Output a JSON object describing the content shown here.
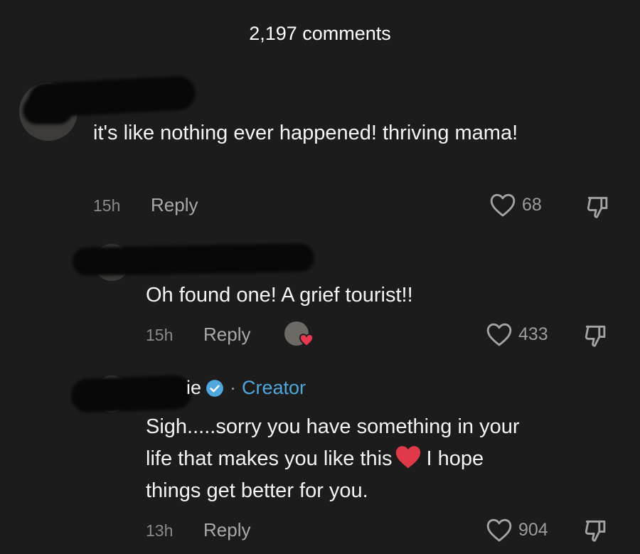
{
  "header": {
    "comment_count": "2,197 comments"
  },
  "comments": [
    {
      "text": "it's like nothing ever happened! thriving mama!",
      "time": "15h",
      "reply_label": "Reply",
      "likes": "68"
    },
    {
      "text": "Oh found one! A grief tourist!!",
      "time": "15h",
      "reply_label": "Reply",
      "likes": "433"
    },
    {
      "name_suffix": "ie",
      "creator_label": "Creator",
      "separator": "·",
      "text_line1": "Sigh.....sorry you have something in your",
      "text_line2_a": "life that makes you like this",
      "text_line2_b": "I hope",
      "text_line3": "things get better for you.",
      "time": "13h",
      "reply_label": "Reply",
      "likes": "904"
    }
  ],
  "icons": {
    "like": "heart-outline-icon",
    "dislike": "thumbs-down-icon",
    "verified": "verified-badge-icon",
    "creator_liked": "creator-liked-heart-icon",
    "emoji": "red-heart-emoji"
  },
  "colors": {
    "background": "#1c1c1c",
    "creator_accent": "#4fa7dd",
    "heart_emoji": "#e03a4a"
  }
}
